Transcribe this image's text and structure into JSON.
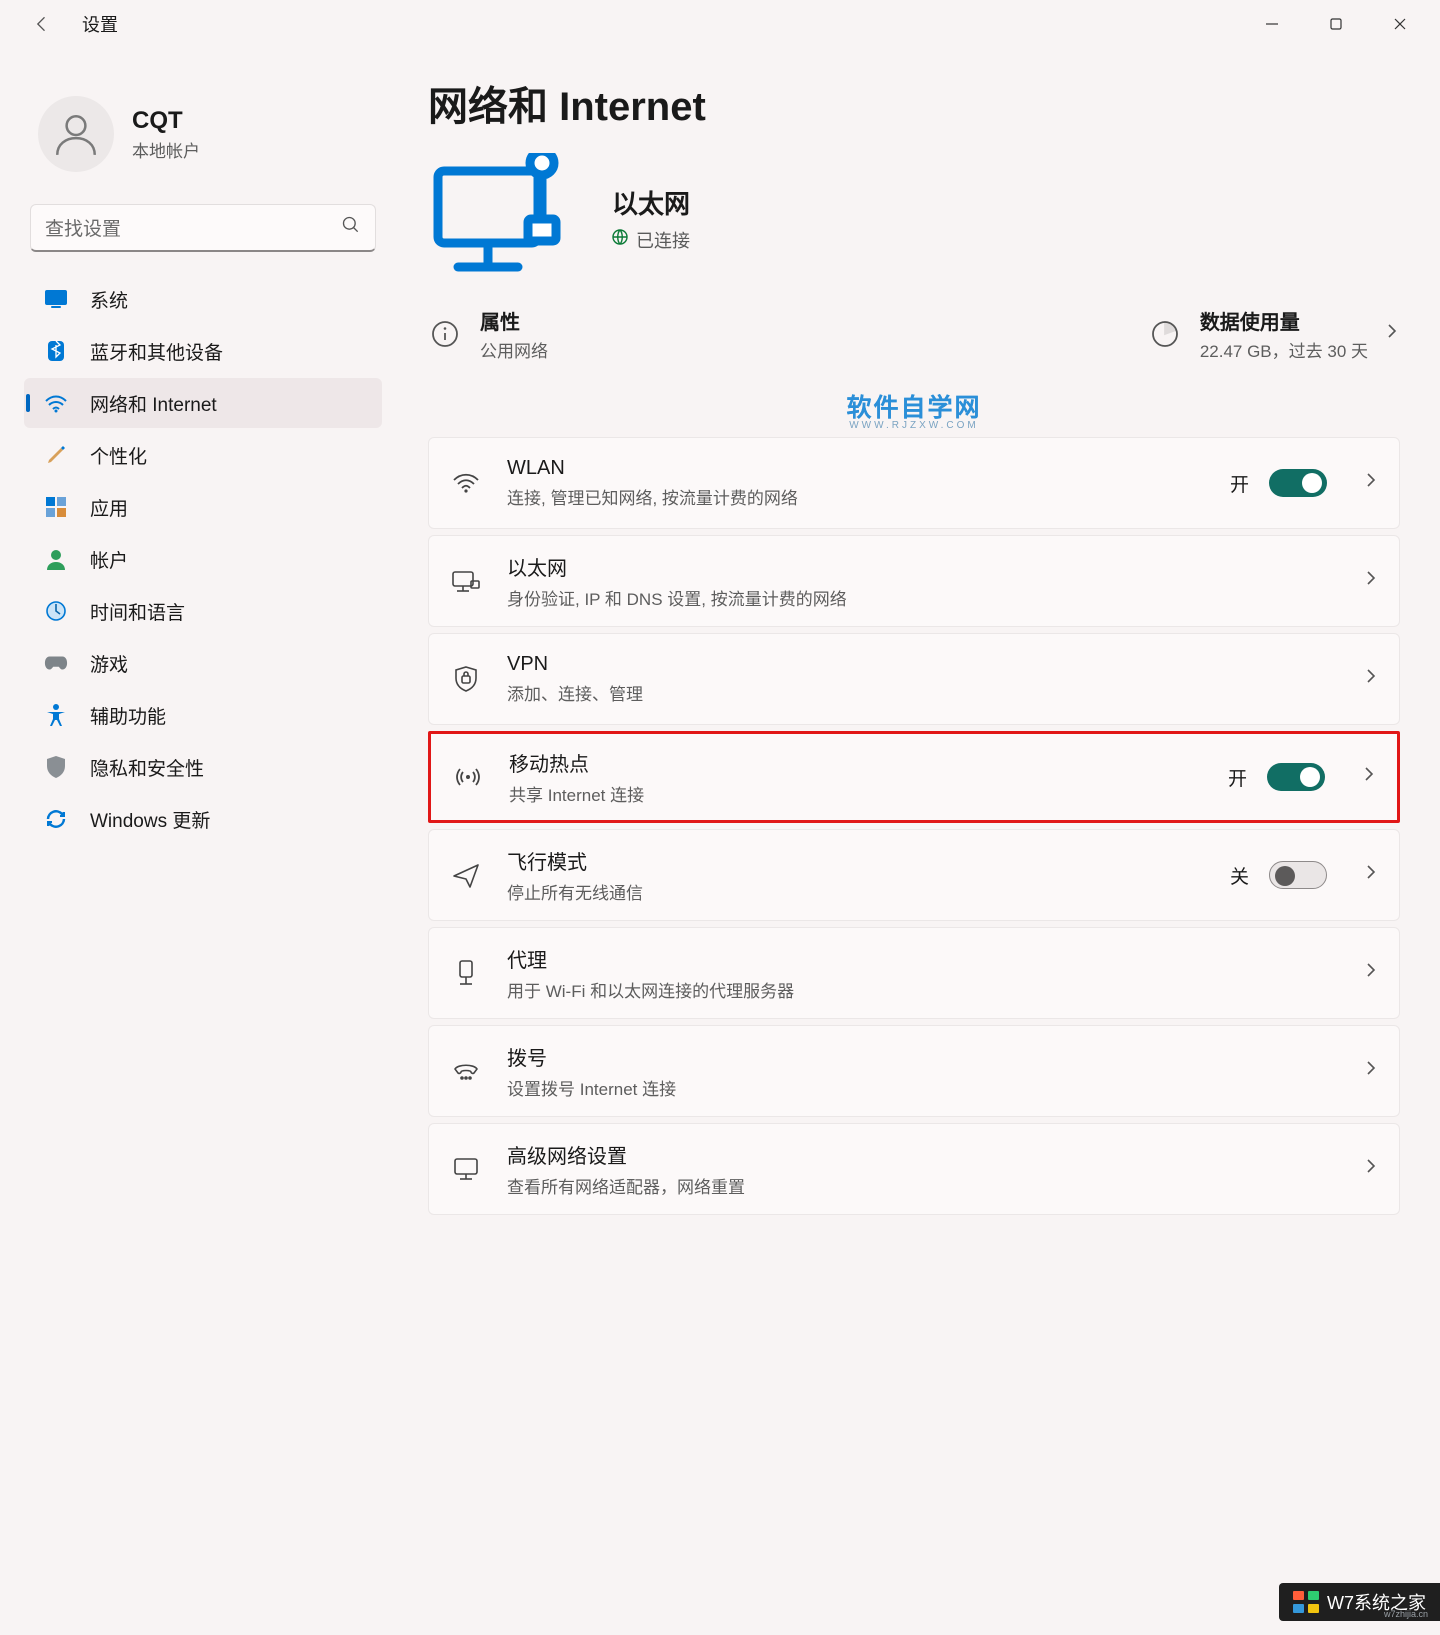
{
  "app": {
    "title": "设置"
  },
  "profile": {
    "name": "CQT",
    "subtitle": "本地帐户"
  },
  "search": {
    "placeholder": "查找设置"
  },
  "nav": {
    "items": [
      {
        "label": "系统"
      },
      {
        "label": "蓝牙和其他设备"
      },
      {
        "label": "网络和 Internet"
      },
      {
        "label": "个性化"
      },
      {
        "label": "应用"
      },
      {
        "label": "帐户"
      },
      {
        "label": "时间和语言"
      },
      {
        "label": "游戏"
      },
      {
        "label": "辅助功能"
      },
      {
        "label": "隐私和安全性"
      },
      {
        "label": "Windows 更新"
      }
    ]
  },
  "page": {
    "title": "网络和 Internet",
    "status": {
      "name": "以太网",
      "state": "已连接"
    },
    "summary": {
      "properties": {
        "title": "属性",
        "subtitle": "公用网络"
      },
      "usage": {
        "title": "数据使用量",
        "subtitle": "22.47 GB，过去 30 天"
      }
    },
    "watermark": {
      "main": "软件自学网",
      "sub": "WWW.RJZXW.COM"
    },
    "rows": {
      "wlan": {
        "title": "WLAN",
        "subtitle": "连接, 管理已知网络, 按流量计费的网络",
        "toggleText": "开"
      },
      "eth": {
        "title": "以太网",
        "subtitle": "身份验证, IP 和 DNS 设置, 按流量计费的网络"
      },
      "vpn": {
        "title": "VPN",
        "subtitle": "添加、连接、管理"
      },
      "hotspot": {
        "title": "移动热点",
        "subtitle": "共享 Internet 连接",
        "toggleText": "开"
      },
      "airplane": {
        "title": "飞行模式",
        "subtitle": "停止所有无线通信",
        "toggleText": "关"
      },
      "proxy": {
        "title": "代理",
        "subtitle": "用于 Wi-Fi 和以太网连接的代理服务器"
      },
      "dial": {
        "title": "拨号",
        "subtitle": "设置拨号 Internet 连接"
      },
      "adv": {
        "title": "高级网络设置",
        "subtitle": "查看所有网络适配器，网络重置"
      }
    }
  },
  "footer": {
    "text": "W7系统之家",
    "tiny": "w7zhijia.cn"
  }
}
